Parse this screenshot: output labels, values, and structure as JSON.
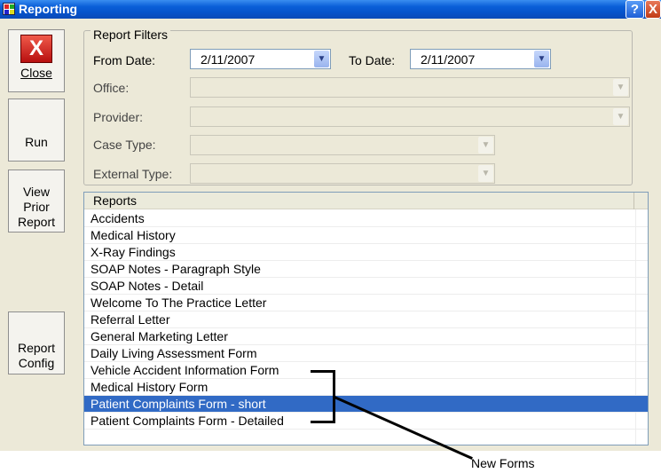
{
  "window": {
    "title": "Reporting",
    "help_label": "?",
    "close_label": "X"
  },
  "sidebar": {
    "close_label": "Close",
    "close_icon_glyph": "X",
    "run_label": "Run",
    "view_prior_line1": "View",
    "view_prior_line2": "Prior",
    "view_prior_line3": "Report",
    "report_config_line1": "Report",
    "report_config_line2": "Config"
  },
  "filters": {
    "legend": "Report Filters",
    "from_date_label": "From Date:",
    "from_date_value": "2/11/2007",
    "to_date_label": "To Date:",
    "to_date_value": "2/11/2007",
    "office_label": "Office:",
    "office_value": "",
    "provider_label": "Provider:",
    "provider_value": "",
    "case_type_label": "Case Type:",
    "case_type_value": "",
    "external_type_label": "External Type:",
    "external_type_value": ""
  },
  "reports": {
    "header": "Reports",
    "items": [
      "Accidents",
      "Medical History",
      "X-Ray Findings",
      "SOAP Notes - Paragraph Style",
      "SOAP Notes - Detail",
      "Welcome To The Practice Letter",
      "Referral Letter",
      "General Marketing Letter",
      "Daily Living Assessment Form",
      "Vehicle Accident Information Form",
      "Medical History Form",
      "Patient Complaints Form - short",
      "Patient Complaints Form - Detailed"
    ],
    "selected_index": 11
  },
  "annotation": {
    "text": "New Forms"
  },
  "icons": {
    "dropdown_arrow": "chevron-down-icon",
    "close_button": "close-icon",
    "app": "app-icon"
  }
}
